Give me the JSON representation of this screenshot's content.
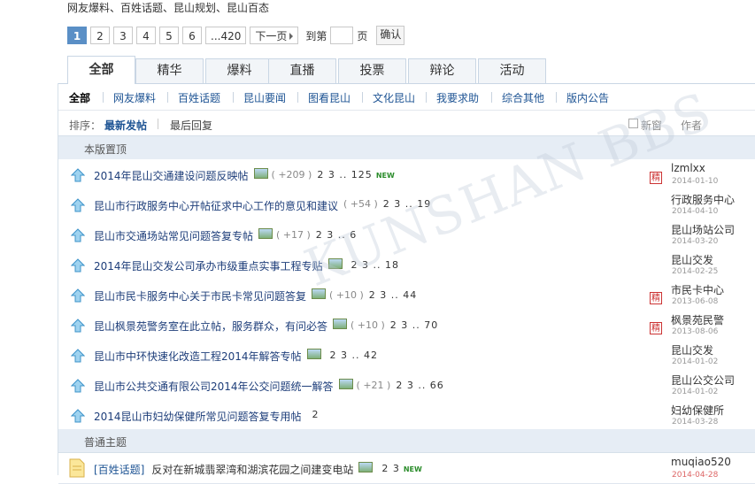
{
  "breadcrumb_text": "网友爆料、百姓话题、昆山规划、昆山百态",
  "pager": {
    "pages": [
      "1",
      "2",
      "3",
      "4",
      "5",
      "6",
      "...420"
    ],
    "active": "1",
    "next_label": "下一页",
    "goto_prefix": "到第",
    "goto_suffix": "页",
    "confirm_label": "确认"
  },
  "tabs": [
    "全部",
    "精华",
    "爆料",
    "直播",
    "投票",
    "辩论",
    "活动"
  ],
  "subnav": [
    "全部",
    "网友爆料",
    "百姓话题",
    "昆山要闻",
    "图看昆山",
    "文化昆山",
    "我要求助",
    "综合其他",
    "版内公告"
  ],
  "sortbar": {
    "label": "排序：",
    "sort_latest": "最新发帖",
    "sort_reply": "最后回复",
    "new_window": "新窗",
    "author": "作者"
  },
  "sections": {
    "pinned": "本版置顶",
    "normal": "普通主题"
  },
  "pinned_threads": [
    {
      "title": "2014年昆山交通建设问题反映帖",
      "has_image": true,
      "count": "( +209 )",
      "pages": "2 3 .. 125",
      "is_new": true,
      "new_label": "NEW",
      "pin": true,
      "author": "lzmlxx",
      "date": "2014-01-10"
    },
    {
      "title": "昆山市行政服务中心开帖征求中心工作的意见和建议",
      "has_image": false,
      "count": "( +54 )",
      "pages": "2 3 .. 19",
      "is_new": false,
      "pin": false,
      "author": "行政服务中心",
      "date": "2014-04-10"
    },
    {
      "title": "昆山市交通场站常见问题答复专帖",
      "has_image": true,
      "count": "( +17 )",
      "pages": "2 3 .. 6",
      "is_new": false,
      "pin": false,
      "author": "昆山场站公司",
      "date": "2014-03-20"
    },
    {
      "title": "2014年昆山交发公司承办市级重点实事工程专贴",
      "has_image": true,
      "count": "",
      "pages": "2 3 .. 18",
      "is_new": false,
      "pin": false,
      "author": "昆山交发",
      "date": "2014-02-25"
    },
    {
      "title": "昆山市民卡服务中心关于市民卡常见问题答复",
      "has_image": true,
      "count": "( +10 )",
      "pages": "2 3 .. 44",
      "is_new": false,
      "pin": true,
      "author": "市民卡中心",
      "date": "2013-06-08"
    },
    {
      "title": "昆山枫景苑警务室在此立帖，服务群众，有问必答",
      "has_image": true,
      "count": "( +10 )",
      "pages": "2 3 .. 70",
      "is_new": false,
      "pin": true,
      "author": "枫景苑民警",
      "date": "2013-08-06"
    },
    {
      "title": "昆山市中环快速化改造工程2014年解答专帖",
      "has_image": true,
      "count": "",
      "pages": "2 3 .. 42",
      "is_new": false,
      "pin": false,
      "author": "昆山交发",
      "date": "2014-01-02"
    },
    {
      "title": "昆山市公共交通有限公司2014年公交问题统一解答",
      "has_image": true,
      "count": "( +21 )",
      "pages": "2 3 .. 66",
      "is_new": false,
      "pin": false,
      "author": "昆山公交公司",
      "date": "2014-01-02"
    },
    {
      "title": "2014昆山市妇幼保健所常见问题答复专用帖",
      "has_image": false,
      "count": "",
      "pages": "2",
      "is_new": false,
      "pin": false,
      "author": "妇幼保健所",
      "date": "2014-03-28"
    }
  ],
  "normal_threads": [
    {
      "category": "[百姓话题]",
      "title": "反对在新城翡翠湾和湖滨花园之间建变电站",
      "has_image": true,
      "pages": "2 3",
      "is_new": true,
      "new_label": "NEW",
      "author": "muqiao520",
      "date": "2014-04-28"
    }
  ],
  "pin_label": "精",
  "colors": {
    "accent": "#5a8fc6",
    "link": "#1e3e7a",
    "section_bg": "#e6edf5"
  }
}
